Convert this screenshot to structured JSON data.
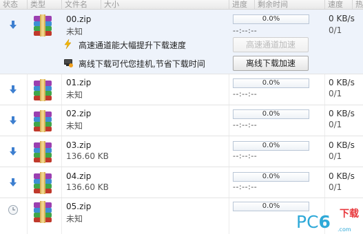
{
  "header": {
    "columns": [
      "状态",
      "类型",
      "文件名",
      "大小",
      "进度",
      "剩余时间",
      "速度",
      "热"
    ]
  },
  "rows": [
    {
      "status_icon": "download-arrow-icon",
      "name": "00.zip",
      "size": "未知",
      "progress_text": "0.0%",
      "progress": 0,
      "remaining": "--:--:--",
      "speed": "0 KB/s",
      "connections": "0/1"
    },
    {
      "status_icon": "download-arrow-icon",
      "name": "01.zip",
      "size": "未知",
      "progress_text": "0.0%",
      "progress": 0,
      "remaining": "--:--:--",
      "speed": "0 KB/s",
      "connections": "0/1"
    },
    {
      "status_icon": "download-arrow-icon",
      "name": "02.zip",
      "size": "未知",
      "progress_text": "0.0%",
      "progress": 0,
      "remaining": "--:--:--",
      "speed": "0 KB/s",
      "connections": "0/1"
    },
    {
      "status_icon": "download-arrow-icon",
      "name": "03.zip",
      "size": "136.60 KB",
      "progress_text": "0.0%",
      "progress": 0,
      "remaining": "--:--:--",
      "speed": "0 KB/s",
      "connections": "0/1"
    },
    {
      "status_icon": "download-arrow-icon",
      "name": "04.zip",
      "size": "136.60 KB",
      "progress_text": "0.0%",
      "progress": 0,
      "remaining": "--:--:--",
      "speed": "0 KB/s",
      "connections": "0/1"
    },
    {
      "status_icon": "clock-waiting-icon",
      "name": "05.zip",
      "size": "未知",
      "progress_text": "0.0%",
      "progress": 0,
      "remaining": "",
      "speed": "",
      "connections": ""
    }
  ],
  "promo": {
    "high_speed_text": "高速通道能大幅提升下载速度",
    "high_speed_button": "高速通道加速",
    "offline_text": "离线下载可代您挂机,节省下载时间",
    "offline_button": "离线下载加速"
  },
  "watermark": {
    "main_left": "PC",
    "main_six": "6",
    "sub": "下载",
    "url": ".com"
  },
  "colors": {
    "selected_row": "#eef3fb",
    "accent_blue": "#3d7fd0",
    "watermark_blue": "#2fa9d8",
    "watermark_red": "#e8363b"
  }
}
